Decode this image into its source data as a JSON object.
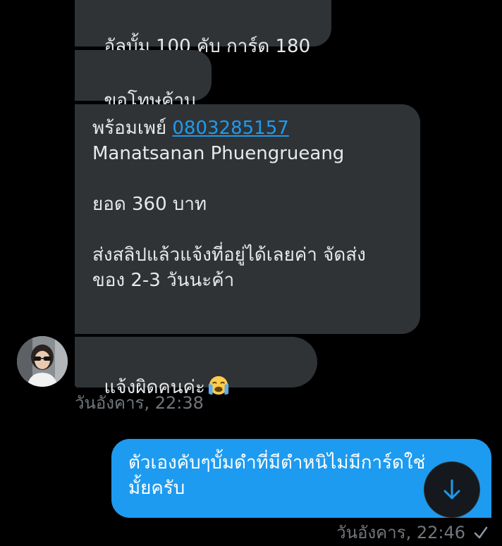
{
  "messages": {
    "m1": "อัลบั้ม 100 คับ การ์ด 180",
    "m2": "ขอโทษค้าบ",
    "m3": {
      "prefix": "พร้อมเพย์ ",
      "phone": "0803285157",
      "rest": "\nManatsanan Phuengrueang\n\nยอด 360 บาท\n\nส่งสลิปแล้วแจ้งที่อยู่ได้เลยค่า จัดส่ง\nของ 2-3 วันนะค้า"
    },
    "m4": "แจ้งผิดคนค่ะ",
    "m4_emoji": "loudly-crying-face-emoji",
    "timestamp_received": "วันอังคาร, 22:38",
    "sent": "ตัวเองคับๆบั้มดำที่มีตำหนิไม่มีการ์ดใช่\nมั้ยครับ",
    "timestamp_sent": "วันอังคาร, 22:46"
  },
  "icons": {
    "scroll_down": "arrow-down-icon",
    "read_status": "checkmark-icon",
    "avatar": "user-avatar"
  },
  "colors": {
    "background": "#000000",
    "received_bubble": "#2f3336",
    "sent_bubble": "#1d9bf0",
    "link": "#1d9bf0",
    "timestamp": "#71767b"
  }
}
